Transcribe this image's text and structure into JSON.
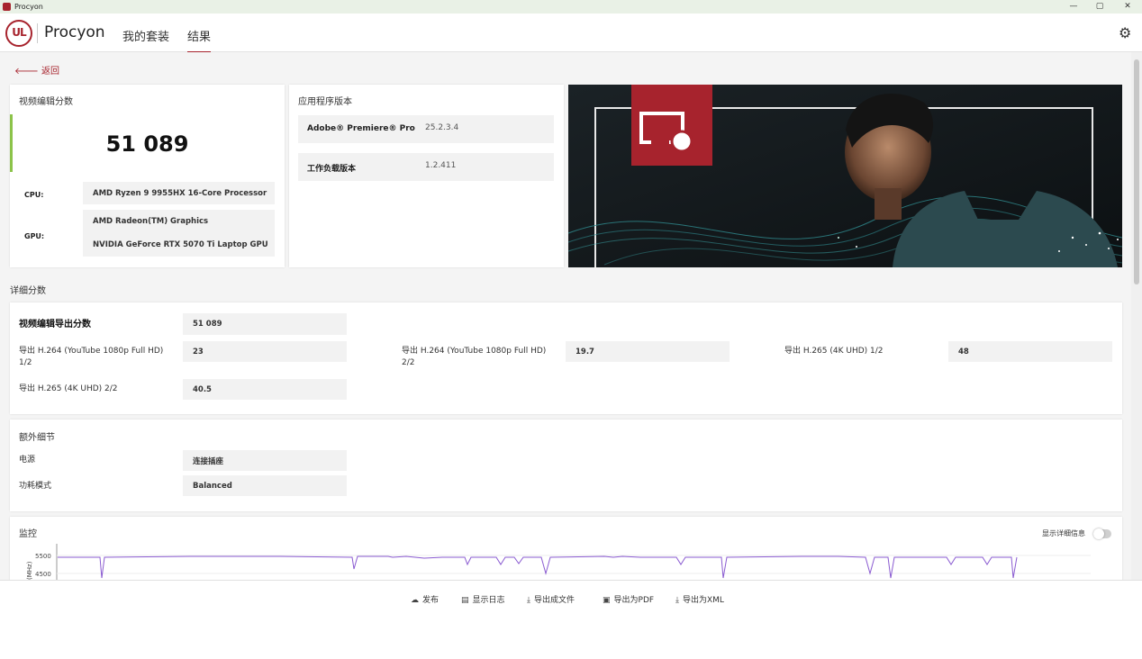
{
  "window": {
    "title": "Procyon",
    "minimize": "—",
    "maximize": "▢",
    "close": "✕"
  },
  "nav": {
    "logo_text": "UL",
    "brand": "Procyon",
    "tabs": [
      "我的套装",
      "结果"
    ],
    "active_tab": 1
  },
  "back_label": "返回",
  "score_card": {
    "title": "视频编辑分数",
    "score": "51 089",
    "cpu_label": "CPU:",
    "cpu_value": "AMD Ryzen 9 9955HX 16-Core Processor",
    "gpu_label": "GPU:",
    "gpu_values": [
      "AMD Radeon(TM) Graphics",
      "NVIDIA GeForce RTX 5070 Ti Laptop GPU"
    ]
  },
  "version_card": {
    "title": "应用程序版本",
    "rows": [
      {
        "key": "Adobe® Premiere® Pro",
        "value": "25.2.3.4"
      },
      {
        "key": "工作负载版本",
        "value": "1.2.411"
      }
    ]
  },
  "details": {
    "title": "详细分数",
    "main_label": "视频编辑导出分数",
    "main_value": "51 089",
    "items": [
      {
        "label": "导出 H.264 (YouTube 1080p Full HD) 1/2",
        "value": "23"
      },
      {
        "label": "导出 H.264 (YouTube 1080p Full HD) 2/2",
        "value": "19.7"
      },
      {
        "label": "导出 H.265 (4K UHD) 1/2",
        "value": "48"
      },
      {
        "label": "导出 H.265 (4K UHD) 2/2",
        "value": "40.5"
      }
    ]
  },
  "extra": {
    "title": "额外细节",
    "rows": [
      {
        "label": "电源",
        "value": "连接插座"
      },
      {
        "label": "功耗模式",
        "value": "Balanced"
      }
    ]
  },
  "monitor": {
    "title": "监控",
    "toggle_label": "显示详细信息",
    "y_ticks": [
      "5500",
      "4500"
    ],
    "y_unit": "(MHz)",
    "colors": {
      "line": "#8a5bd1"
    }
  },
  "footer": {
    "buttons": [
      {
        "icon": "cloud-upload-icon",
        "glyph": "☁",
        "label": "发布"
      },
      {
        "icon": "document-icon",
        "glyph": "▤",
        "label": "显示日志"
      },
      {
        "icon": "download-icon",
        "glyph": "⤓",
        "label": "导出成文件"
      },
      {
        "icon": "save-icon",
        "glyph": "▣",
        "label": "导出为PDF"
      },
      {
        "icon": "download-icon",
        "glyph": "⤓",
        "label": "导出为XML"
      }
    ]
  },
  "colors": {
    "accent": "#a7232d",
    "score_bar": "#8cc34a"
  }
}
